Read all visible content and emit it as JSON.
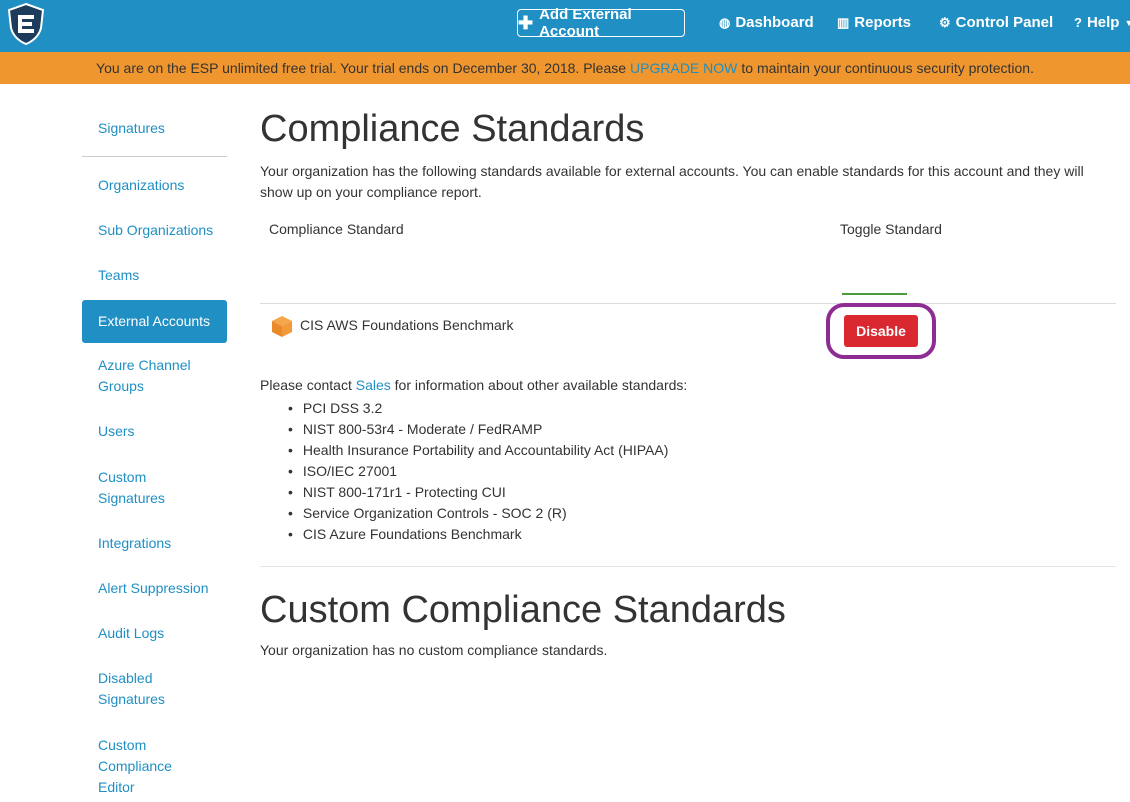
{
  "topbar": {
    "logo_icon": "shield-logo-icon",
    "add_account_label": "Add External Account",
    "nav": [
      {
        "label": "Dashboard",
        "icon": "dashboard-icon"
      },
      {
        "label": "Reports",
        "icon": "bar-chart-icon"
      },
      {
        "label": "Control Panel",
        "icon": "gears-icon"
      },
      {
        "label": "Help",
        "icon": "question-icon"
      }
    ],
    "color": "#1f8fc4"
  },
  "banner": {
    "text_before": "You are on the ESP unlimited free trial. Your trial ends on December 30, 2018. Please",
    "link": "UPGRADE NOW",
    "text_after": "to maintain your continuous security protection.",
    "color": "#f0962e"
  },
  "sidebar": {
    "items": [
      {
        "label": "Signatures"
      },
      {
        "label": "Organizations"
      },
      {
        "label": "Sub Organizations"
      },
      {
        "label": "Teams"
      },
      {
        "label": "External Accounts",
        "active": true
      },
      {
        "label": "Azure Channel Groups"
      },
      {
        "label": "Users"
      },
      {
        "label": "Custom Signatures"
      },
      {
        "label": "Integrations"
      },
      {
        "label": "Alert Suppression"
      },
      {
        "label": "Audit Logs"
      },
      {
        "label": "Disabled Signatures"
      },
      {
        "label": "Custom Compliance Editor"
      }
    ]
  },
  "main": {
    "title": "Compliance Standards",
    "intro": "Your organization has the following standards available for external accounts. You can enable standards for this account and they will show up on your compliance report.",
    "columns": {
      "standard": "Compliance Standard",
      "toggle": "Toggle Standard"
    },
    "row": {
      "name": "CIS AWS Foundations Benchmark",
      "icon": "aws-box-icon",
      "button": "Disable"
    },
    "contact_before": "Please contact",
    "contact_link": "Sales",
    "contact_after": "for information about other available standards:",
    "other_standards": [
      "PCI DSS 3.2",
      "NIST 800-53r4 - Moderate / FedRAMP",
      "Health Insurance Portability and Accountability Act (HIPAA)",
      "ISO/IEC 27001",
      "NIST 800-171r1 - Protecting CUI",
      "Service Organization Controls - SOC 2 (R)",
      "CIS Azure Foundations Benchmark"
    ],
    "custom_title": "Custom Compliance Standards",
    "custom_note": "Your organization has no custom compliance standards."
  }
}
